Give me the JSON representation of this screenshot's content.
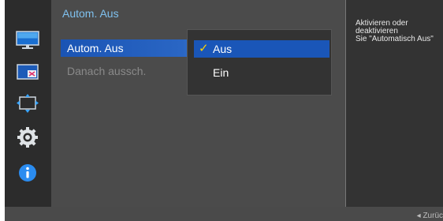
{
  "menu": {
    "title": "Autom. Aus",
    "items": [
      {
        "label": "Autom. Aus",
        "state": "selected"
      },
      {
        "label": "Danach aussch.",
        "state": "disabled"
      }
    ]
  },
  "dropdown": {
    "options": [
      {
        "label": "Aus",
        "selected": true
      },
      {
        "label": "Ein",
        "selected": false
      }
    ]
  },
  "help": {
    "text": "Aktivieren oder\ndeaktivieren\nSie \"Automatisch Aus\""
  },
  "footer": {
    "back_arrow": "◂",
    "back_label": "Zurüc"
  },
  "sidebar": {
    "icons": [
      "monitor-icon",
      "picture-adjust-icon",
      "screen-size-icon",
      "settings-icon",
      "info-icon"
    ]
  },
  "colors": {
    "accent_blue": "#1a56b8",
    "title_blue": "#7fc1ef",
    "check_yellow": "#ffd400"
  }
}
